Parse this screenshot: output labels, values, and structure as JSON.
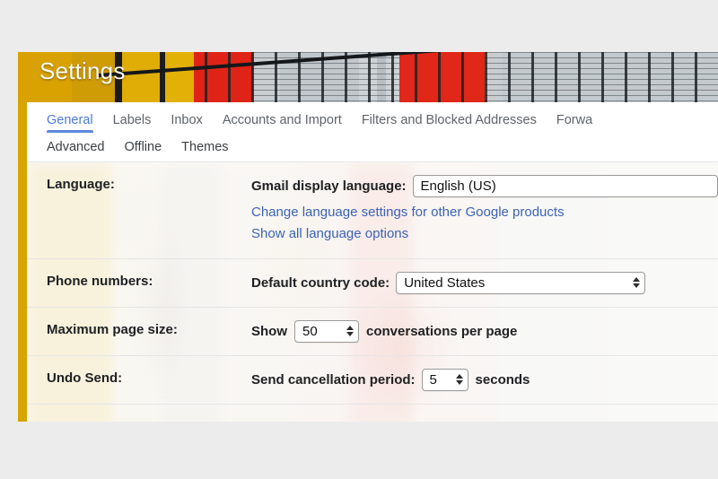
{
  "window": {
    "title": "Settings"
  },
  "tabs": {
    "row1": [
      {
        "label": "General",
        "active": true
      },
      {
        "label": "Labels",
        "active": false
      },
      {
        "label": "Inbox",
        "active": false
      },
      {
        "label": "Accounts and Import",
        "active": false
      },
      {
        "label": "Filters and Blocked Addresses",
        "active": false
      },
      {
        "label": "Forwa",
        "active": false
      }
    ],
    "row2": [
      {
        "label": "Advanced"
      },
      {
        "label": "Offline"
      },
      {
        "label": "Themes"
      }
    ]
  },
  "settings": {
    "language": {
      "row_label": "Language:",
      "field_label": "Gmail display language:",
      "value": "English (US)",
      "link_other_products": "Change language settings for other Google products",
      "link_all_options": "Show all language options"
    },
    "phone_numbers": {
      "row_label": "Phone numbers:",
      "field_label": "Default country code:",
      "value": "United States"
    },
    "max_page_size": {
      "row_label": "Maximum page size:",
      "prefix": "Show",
      "value": "50",
      "suffix": "conversations per page"
    },
    "undo_send": {
      "row_label": "Undo Send:",
      "field_label": "Send cancellation period:",
      "value": "5",
      "suffix": "seconds"
    }
  },
  "colors": {
    "accent_blue": "#5b87dd",
    "link_blue": "#3b63b5",
    "theme_gold": "#d9a200",
    "theme_red": "#df2417",
    "desktop_grey": "#ececec"
  }
}
